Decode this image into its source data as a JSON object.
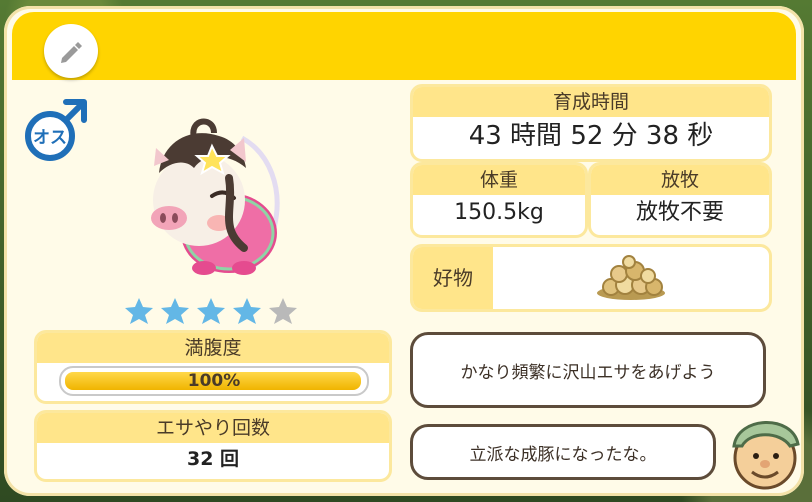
{
  "growth": {
    "label": "育成時間",
    "value": "43 時間 52 分 38 秒"
  },
  "weight": {
    "label": "体重",
    "value": "150.5kg"
  },
  "grazing": {
    "label": "放牧",
    "value": "放牧不要"
  },
  "favorite": {
    "label": "好物"
  },
  "gender": {
    "label": "オス"
  },
  "rating": {
    "filled": 4,
    "total": 5
  },
  "fullness": {
    "label": "満腹度",
    "value": "100%",
    "fraction": 1.0
  },
  "feeding": {
    "label": "エサやり回数",
    "value": "32 回"
  },
  "speech": {
    "advice": "かなり頻繁に沢山エサをあげよう",
    "comment": "立派な成豚になったな。"
  },
  "colors": {
    "accent": "#ffd400",
    "star_filled": "#63b7e6",
    "star_empty": "#b9b9b9",
    "male_blue": "#1f6fb8"
  }
}
